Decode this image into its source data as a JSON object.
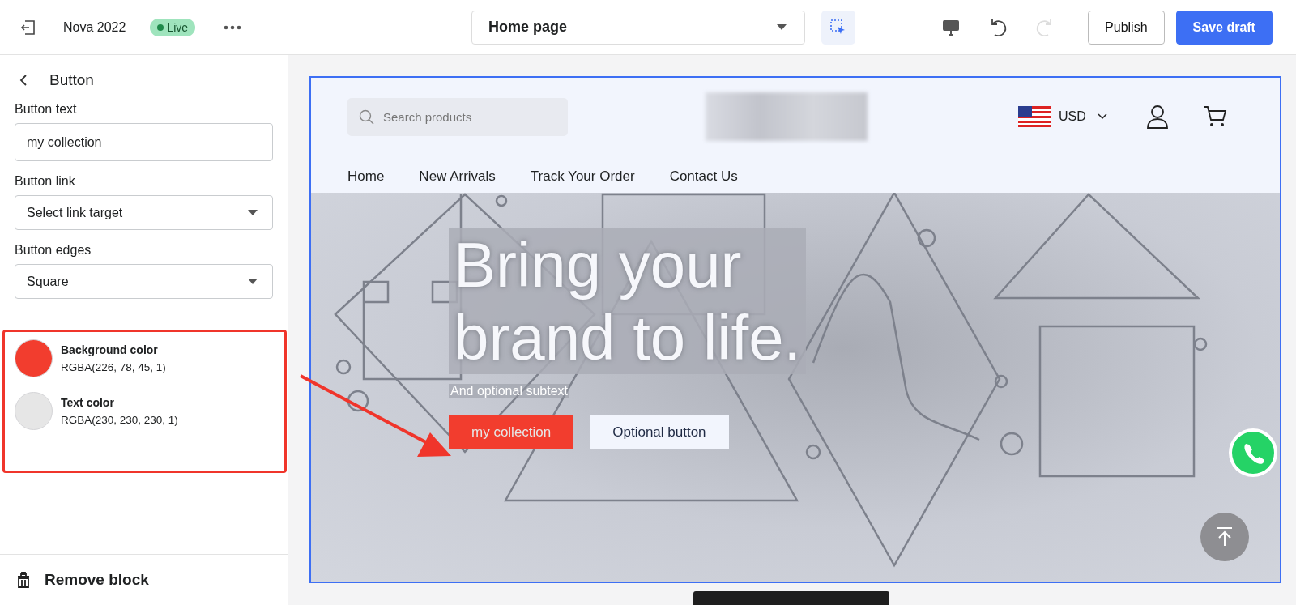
{
  "topbar": {
    "store_name": "Nova 2022",
    "status": "Live",
    "page_select": "Home page",
    "buttons": [
      {
        "label": "Publish",
        "kind": "secondary"
      },
      {
        "label": "Save draft",
        "kind": "primary"
      }
    ]
  },
  "sidebar": {
    "title": "Button",
    "fields": [
      {
        "kind": "text",
        "label": "Button text",
        "value": "my collection"
      },
      {
        "kind": "select",
        "label": "Button link",
        "value": "Select link target"
      },
      {
        "kind": "select",
        "label": "Button edges",
        "value": "Square"
      }
    ],
    "colors": [
      {
        "label": "Background color",
        "value": "RGBA(226, 78, 45, 1)",
        "color": "#f23d2e"
      },
      {
        "label": "Text color",
        "value": "RGBA(230, 230, 230, 1)",
        "color": "#e6e6e6"
      }
    ],
    "remove": "Remove block"
  },
  "preview": {
    "search_placeholder": "Search products",
    "currency": "USD",
    "nav": [
      "Home",
      "New Arrivals",
      "Track Your Order",
      "Contact Us"
    ],
    "hero": {
      "title_lines": [
        "Bring your",
        "brand to life."
      ],
      "subtext": "And optional subtext",
      "buttons": [
        {
          "label": "my collection",
          "kind": "primary"
        },
        {
          "label": "Optional button",
          "kind": "secondary"
        }
      ]
    }
  }
}
